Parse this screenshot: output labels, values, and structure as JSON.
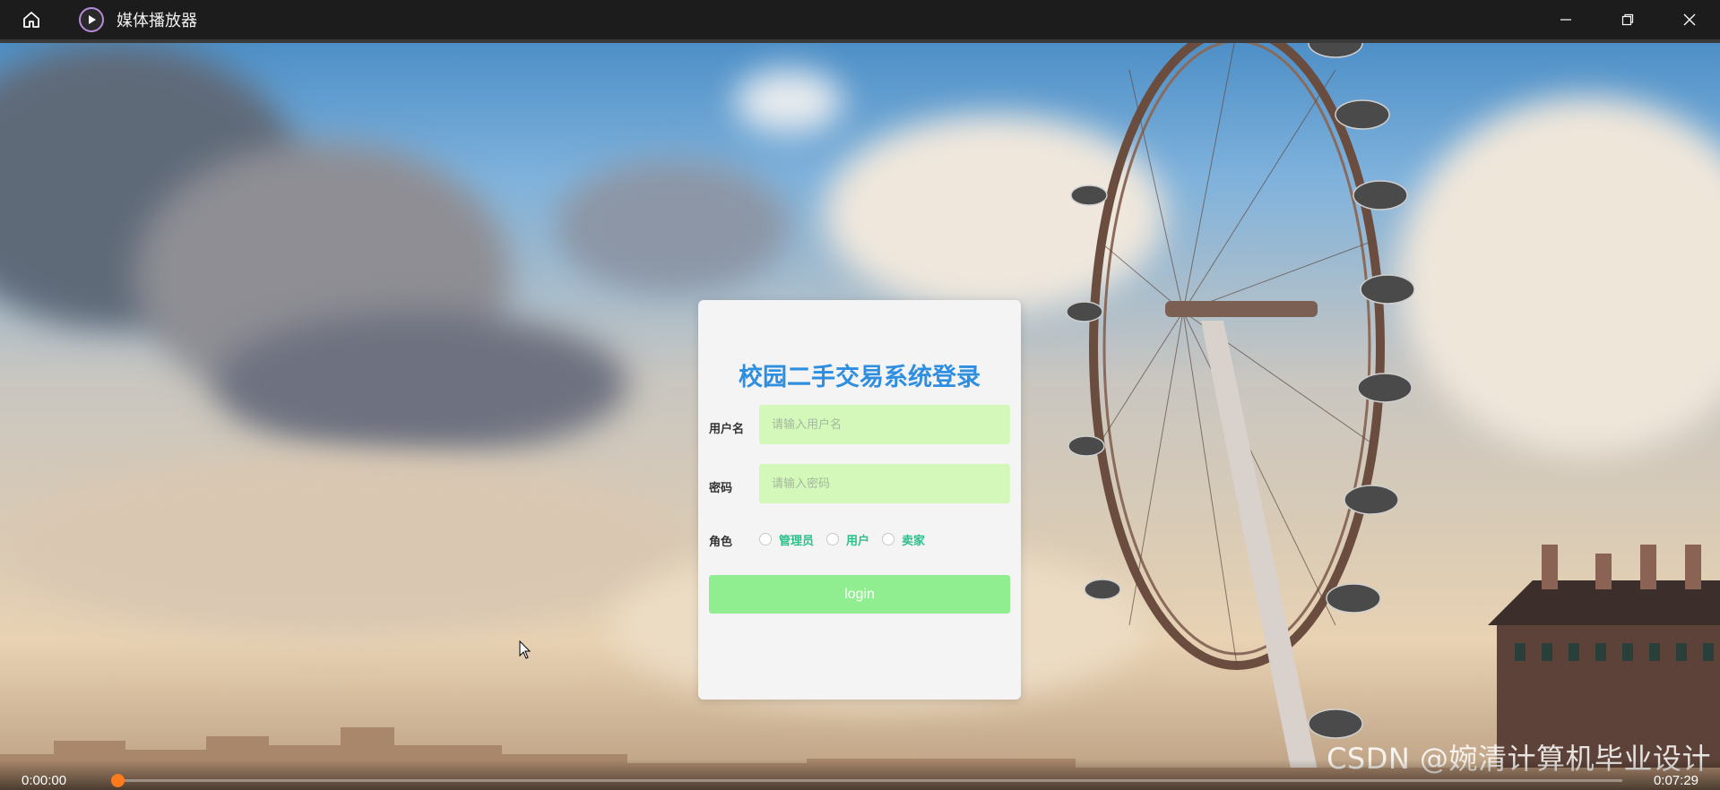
{
  "window": {
    "title": "媒体播放器",
    "home_icon": "home-icon",
    "app_icon": "play-circle-icon",
    "controls": [
      "minimize-icon",
      "restore-icon",
      "close-icon"
    ]
  },
  "login": {
    "heading": "校园二手交易系统登录",
    "username_label": "用户名",
    "username_placeholder": "请输入用户名",
    "password_label": "密码",
    "password_placeholder": "请输入密码",
    "role_label": "角色",
    "roles": [
      "管理员",
      "用户",
      "卖家"
    ],
    "button_label": "login",
    "colors": {
      "heading": "#2e8ee0",
      "field_bg": "#d3f8b9",
      "button_bg": "#90ee90",
      "role_text": "#2bbf8a"
    }
  },
  "player": {
    "current_time": "0:00:00",
    "total_time": "0:07:29",
    "progress": 0,
    "watermark": "CSDN @婉清计算机毕业设计",
    "thumb_color": "#ff7a1a"
  }
}
